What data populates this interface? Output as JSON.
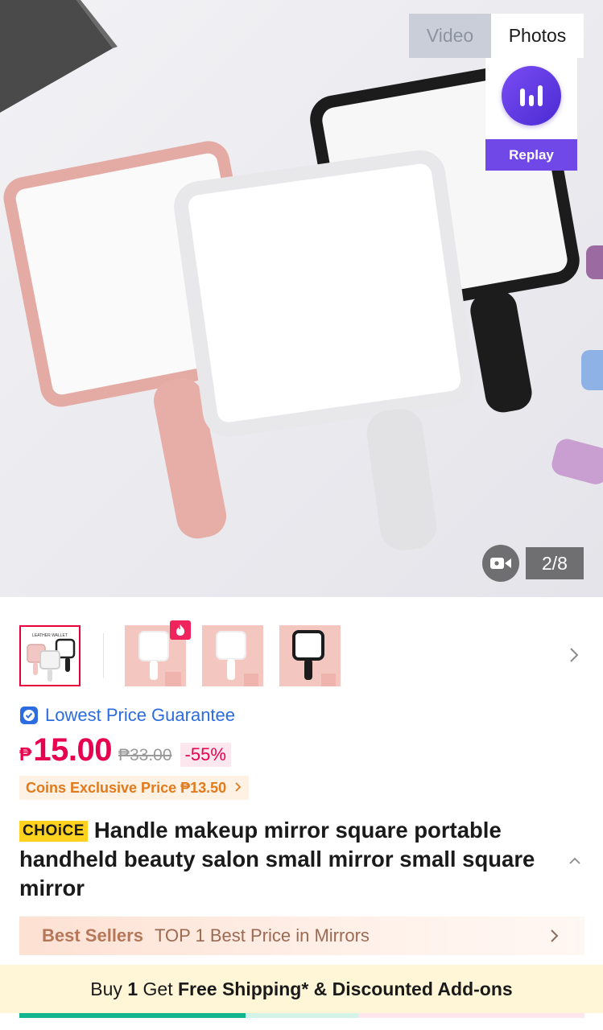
{
  "media": {
    "tabs": [
      {
        "label": "Video",
        "active": false
      },
      {
        "label": "Photos",
        "active": true
      }
    ],
    "replay_label": "Replay",
    "page_counter": "2/8",
    "hero_icon": "video-camera-icon",
    "colors": {
      "replay_accent": "#7048e8"
    }
  },
  "thumbnails": {
    "items": [
      {
        "name": "thumbnail-1",
        "selected": true,
        "tag": "LEATHER WALLET",
        "mirror_colors": [
          "#f2c7c3",
          "#f3f3f3",
          "#222222"
        ]
      },
      {
        "name": "thumbnail-2",
        "selected": false,
        "hot": true,
        "mirror_colors": [
          "#ffffff"
        ]
      },
      {
        "name": "thumbnail-3",
        "selected": false,
        "mirror_colors": [
          "#ffffff"
        ]
      },
      {
        "name": "thumbnail-4",
        "selected": false,
        "mirror_colors": [
          "#222222"
        ]
      }
    ],
    "next_icon": "chevron-right-icon"
  },
  "pricing": {
    "guarantee_label": "Lowest Price Guarantee",
    "currency": "₱",
    "price": "15.00",
    "original_price": "₱33.00",
    "discount": "-55%",
    "coins_label": "Coins Exclusive Price ₱13.50",
    "colors": {
      "price": "#e7004f",
      "guarantee": "#2c6ce0",
      "coins": "#e07a1c"
    }
  },
  "product": {
    "badge": "CHOiCE",
    "title": "Handle makeup mirror square portable handheld beauty salon small mirror small square mirror"
  },
  "best_sellers": {
    "label": "Best Sellers",
    "text": "TOP 1 Best Price in Mirrors"
  },
  "shipping": {
    "prefix": "Buy ",
    "count": "1",
    "middle": " Get ",
    "highlight": "Free Shipping* & Discounted Add-ons",
    "progress": 0.4,
    "colors": {
      "progress": "#12b58e",
      "banner": "#fff6d8"
    }
  }
}
